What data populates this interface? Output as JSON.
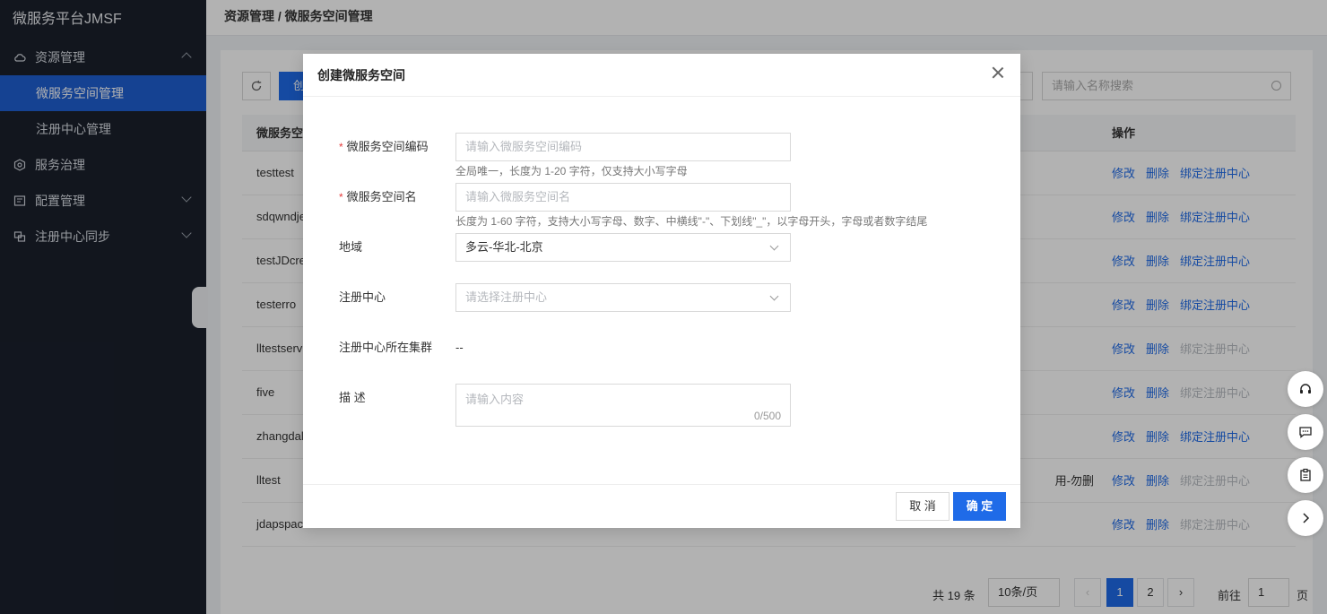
{
  "brand": "微服务平台JMSF",
  "sidebar": {
    "groups": [
      {
        "label": "资源管理"
      },
      {
        "label": "服务治理"
      },
      {
        "label": "配置管理"
      },
      {
        "label": "注册中心同步"
      }
    ],
    "items": [
      {
        "label": "微服务空间管理"
      },
      {
        "label": "注册中心管理"
      }
    ]
  },
  "header": {
    "breadcrumb": "资源管理 / 微服务空间管理"
  },
  "toolbar": {
    "create_label": "创",
    "search_placeholder": "请输入名称搜索"
  },
  "table": {
    "headers": [
      "微服务空",
      "操作"
    ],
    "rows": [
      {
        "name": "testtest",
        "extra": "",
        "bind": "修改",
        "del": "删除",
        "reg": "绑定注册中心",
        "reg_enabled": true
      },
      {
        "name": "sdqwndje",
        "extra": "",
        "bind": "修改",
        "del": "删除",
        "reg": "绑定注册中心",
        "reg_enabled": true
      },
      {
        "name": "testJDcre",
        "extra": "",
        "bind": "修改",
        "del": "删除",
        "reg": "绑定注册中心",
        "reg_enabled": true
      },
      {
        "name": "testerro",
        "extra": "",
        "bind": "修改",
        "del": "删除",
        "reg": "绑定注册中心",
        "reg_enabled": true
      },
      {
        "name": "lltestserv",
        "extra": "",
        "bind": "修改",
        "del": "删除",
        "reg": "绑定注册中心",
        "reg_enabled": false
      },
      {
        "name": "five",
        "extra": "",
        "bind": "修改",
        "del": "删除",
        "reg": "绑定注册中心",
        "reg_enabled": false
      },
      {
        "name": "zhangdal",
        "extra": "",
        "bind": "修改",
        "del": "删除",
        "reg": "绑定注册中心",
        "reg_enabled": true
      },
      {
        "name": "lltest",
        "extra": "用-勿删",
        "bind": "修改",
        "del": "删除",
        "reg": "绑定注册中心",
        "reg_enabled": false
      },
      {
        "name": "jdapspac",
        "extra": "",
        "bind": "修改",
        "del": "删除",
        "reg": "绑定注册中心",
        "reg_enabled": false
      }
    ]
  },
  "pager": {
    "total": "共 19 条",
    "page_size": "10条/页",
    "pages": [
      "1",
      "2"
    ],
    "goto_label": "前往",
    "goto_value": "1",
    "goto_unit": "页"
  },
  "dialog": {
    "title": "创建微服务空间",
    "fields": {
      "code": {
        "label": "微服务空间编码",
        "placeholder": "请输入微服务空间编码",
        "hint": "全局唯一，长度为 1-20 字符，仅支持大小写字母"
      },
      "name": {
        "label": "微服务空间名",
        "placeholder": "请输入微服务空间名",
        "hint": "长度为 1-60 字符，支持大小写字母、数字、中横线\"-\"、下划线\"_\"，以字母开头，字母或者数字结尾"
      },
      "region": {
        "label": "地域",
        "value": "多云-华北-北京"
      },
      "registry": {
        "label": "注册中心",
        "placeholder": "请选择注册中心"
      },
      "cluster": {
        "label": "注册中心所在集群",
        "value": "--"
      },
      "desc": {
        "label": "描 述",
        "placeholder": "请输入内容",
        "count": "0/500"
      }
    },
    "cancel_label": "取 消",
    "ok_label": "确 定"
  }
}
